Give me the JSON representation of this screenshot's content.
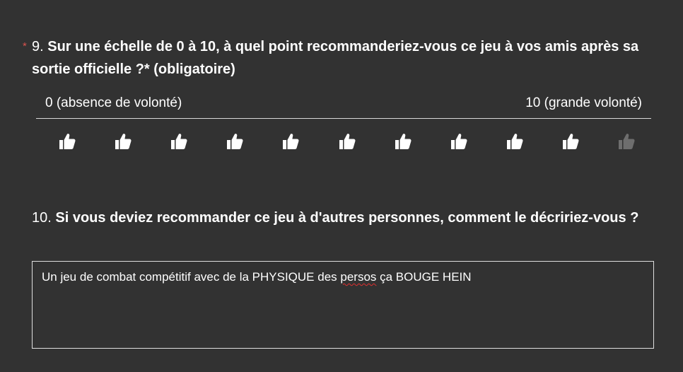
{
  "q9": {
    "required_mark": "*",
    "number": "9.",
    "text": "Sur une échelle de 0 à 10, à quel point recommanderiez-vous ce jeu à vos amis après sa sortie officielle ?* (obligatoire)",
    "scale_min_label": "0 (absence de volonté)",
    "scale_max_label": "10 (grande volonté)",
    "rating_icons": [
      {
        "value": 0,
        "icon": "thumbs-up-icon"
      },
      {
        "value": 1,
        "icon": "thumbs-up-icon"
      },
      {
        "value": 2,
        "icon": "thumbs-up-icon"
      },
      {
        "value": 3,
        "icon": "thumbs-up-icon"
      },
      {
        "value": 4,
        "icon": "thumbs-up-icon"
      },
      {
        "value": 5,
        "icon": "thumbs-up-icon"
      },
      {
        "value": 6,
        "icon": "thumbs-up-icon"
      },
      {
        "value": 7,
        "icon": "thumbs-up-icon"
      },
      {
        "value": 8,
        "icon": "thumbs-up-icon"
      },
      {
        "value": 9,
        "icon": "thumbs-up-icon"
      },
      {
        "value": 10,
        "icon": "thumbs-up-icon"
      }
    ],
    "selected_rating": 9,
    "colors": {
      "selected": "#ffffff",
      "unselected": "#6e6e6e",
      "required": "#d9534f"
    }
  },
  "q10": {
    "number": "10.",
    "text": "Si vous deviez recommander ce jeu à d'autres personnes, comment le décririez-vous ?",
    "answer_before": "Un jeu de combat compétitif avec de la PHYSIQUE des ",
    "answer_misspelled": "persos",
    "answer_after": " ça BOUGE HEIN"
  },
  "theme": {
    "background": "#323232",
    "text": "#ffffff"
  }
}
